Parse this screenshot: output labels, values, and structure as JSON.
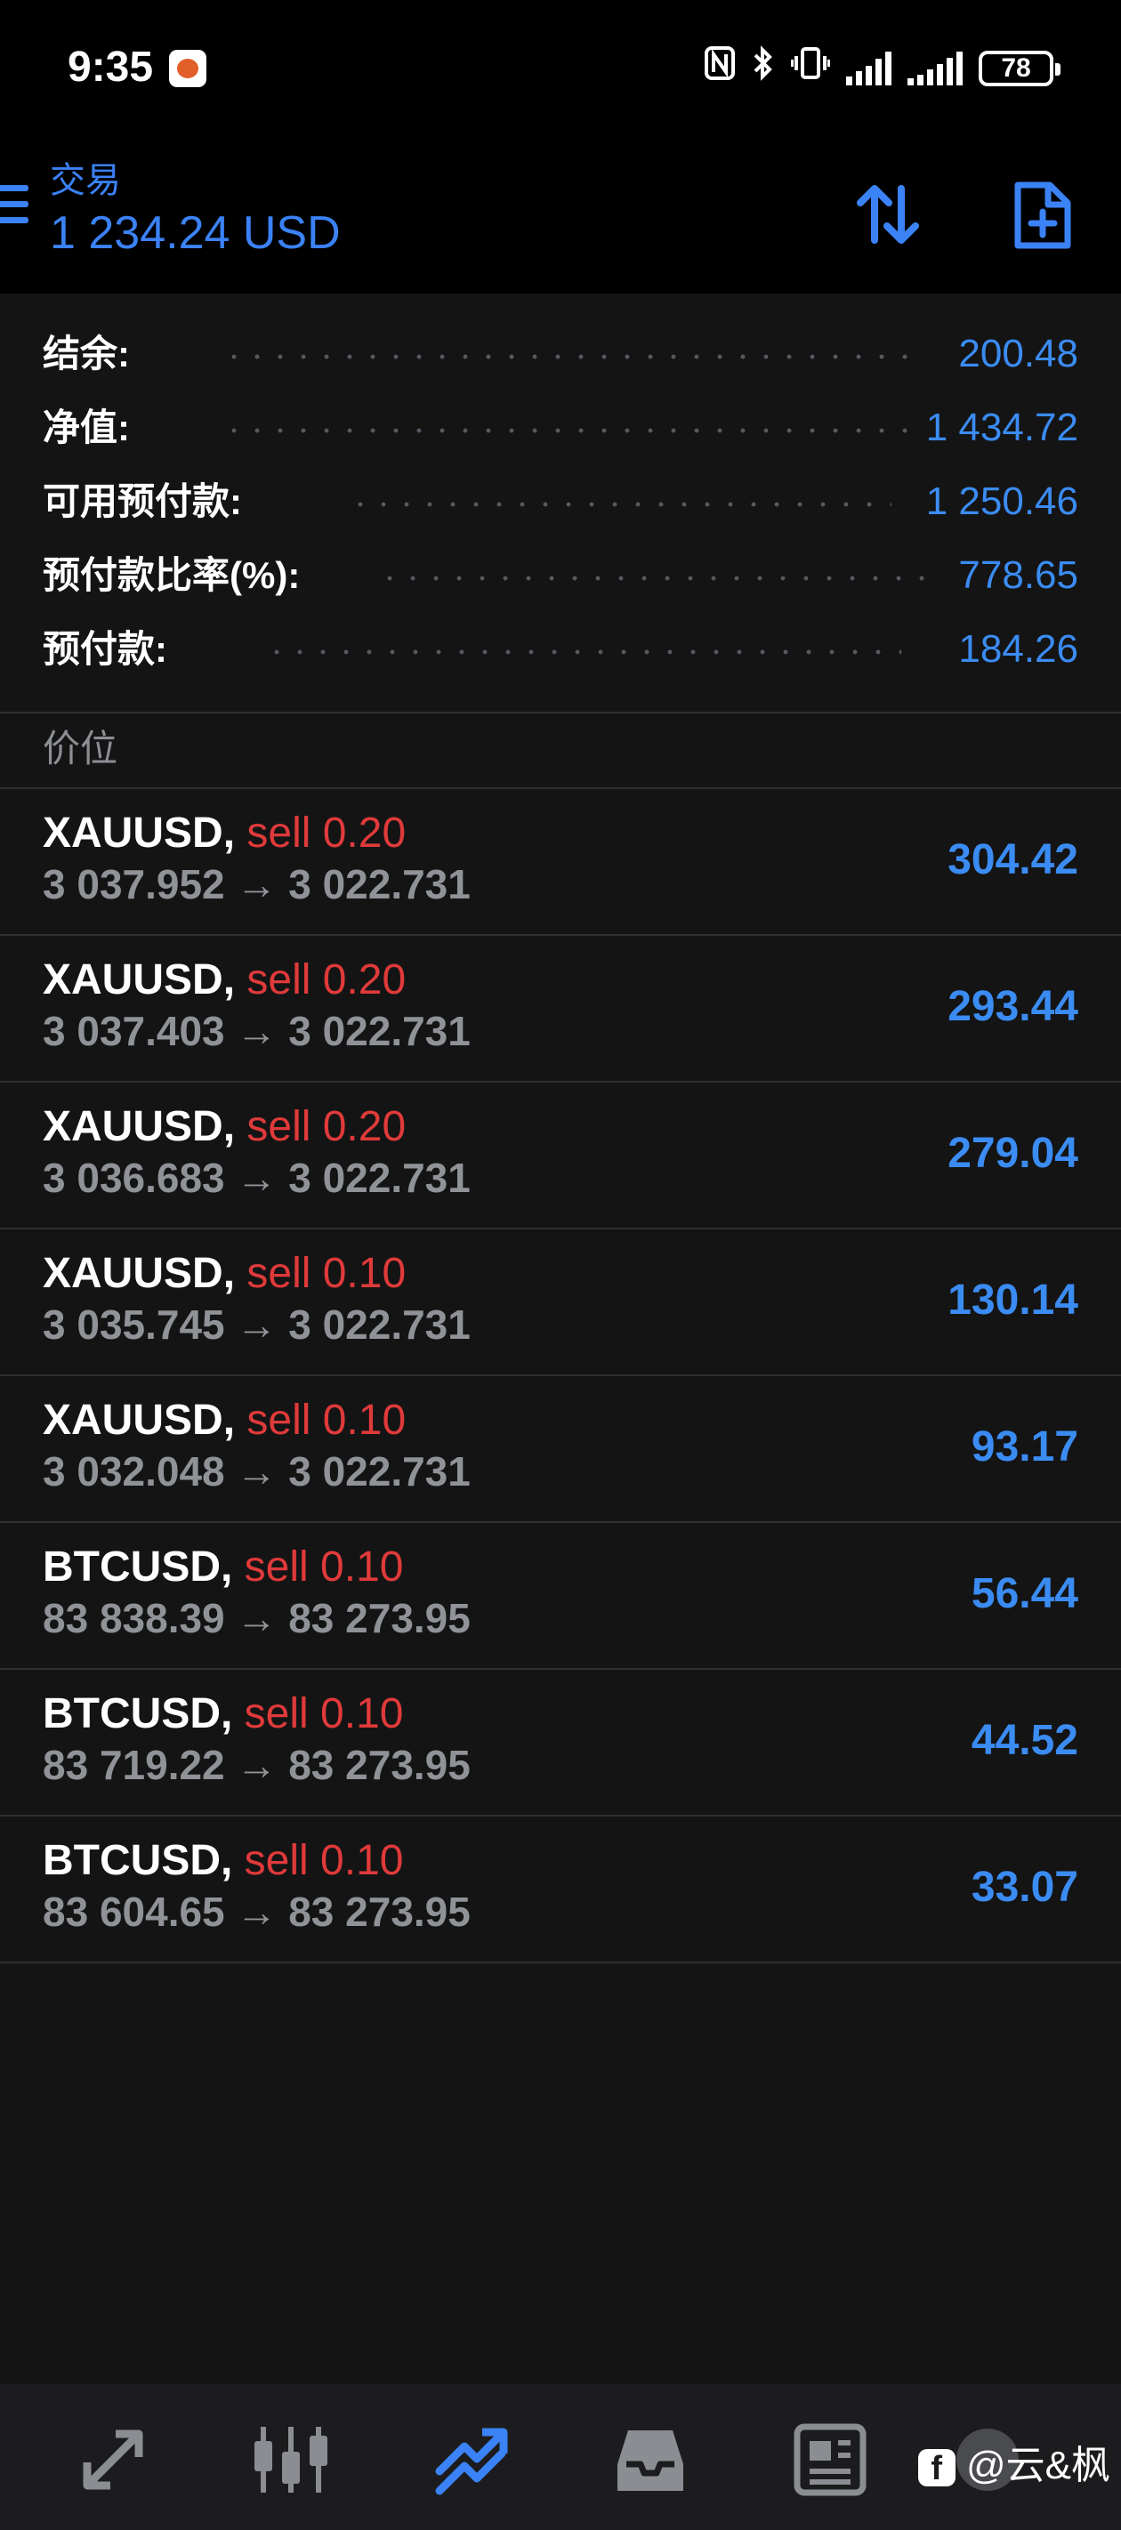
{
  "status_bar": {
    "time": "9:35",
    "battery": "78",
    "icons": [
      "nfc-icon",
      "bluetooth-icon",
      "vibrate-icon",
      "signal-icon",
      "signal-icon"
    ]
  },
  "header": {
    "subtitle": "交易",
    "title": "1 234.24 USD",
    "accent_color": "#3b82f6"
  },
  "summary": [
    {
      "label": "结余:",
      "value": "200.48"
    },
    {
      "label": "净值:",
      "value": "1 434.72"
    },
    {
      "label": "可用预付款:",
      "value": "1 250.46"
    },
    {
      "label": "预付款比率(%):",
      "value": "778.65"
    },
    {
      "label": "预付款:",
      "value": "184.26"
    }
  ],
  "section_title": "价位",
  "positions": [
    {
      "symbol": "XAUUSD,",
      "type": "sell 0.20",
      "prices": "3 037.952 → 3 022.731",
      "profit": "304.42"
    },
    {
      "symbol": "XAUUSD,",
      "type": "sell 0.20",
      "prices": "3 037.403 → 3 022.731",
      "profit": "293.44"
    },
    {
      "symbol": "XAUUSD,",
      "type": "sell 0.20",
      "prices": "3 036.683 → 3 022.731",
      "profit": "279.04"
    },
    {
      "symbol": "XAUUSD,",
      "type": "sell 0.10",
      "prices": "3 035.745 → 3 022.731",
      "profit": "130.14"
    },
    {
      "symbol": "XAUUSD,",
      "type": "sell 0.10",
      "prices": "3 032.048 → 3 022.731",
      "profit": "93.17"
    },
    {
      "symbol": "BTCUSD,",
      "type": "sell 0.10",
      "prices": "83 838.39 → 83 273.95",
      "profit": "56.44"
    },
    {
      "symbol": "BTCUSD,",
      "type": "sell 0.10",
      "prices": "83 719.22 → 83 273.95",
      "profit": "44.52"
    },
    {
      "symbol": "BTCUSD,",
      "type": "sell 0.10",
      "prices": "83 604.65 → 83 273.95",
      "profit": "33.07"
    }
  ],
  "bottom_nav": {
    "items": [
      "quotes-icon",
      "chart-icon",
      "trade-icon",
      "history-icon",
      "news-icon"
    ],
    "active_index": 2
  },
  "watermark": "@云&枫",
  "colors": {
    "profit": "#3b8cf2",
    "sell": "#e03a3a",
    "background": "#141415"
  }
}
